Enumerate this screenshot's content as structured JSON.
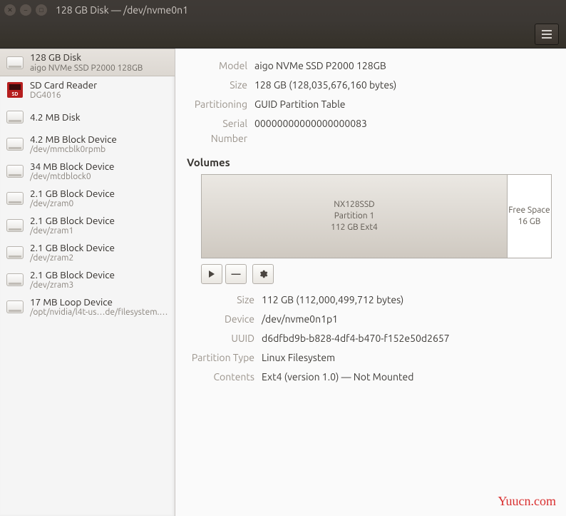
{
  "window": {
    "title": "128 GB Disk — /dev/nvme0n1"
  },
  "sidebar": {
    "devices": [
      {
        "primary": "128 GB Disk",
        "secondary": "aigo NVMe SSD P2000 128GB",
        "icon": "hdd",
        "selected": true
      },
      {
        "primary": "SD Card Reader",
        "secondary": "DG4016",
        "icon": "sd",
        "selected": false
      },
      {
        "primary": "4.2 MB Disk",
        "secondary": "",
        "icon": "hdd",
        "selected": false
      },
      {
        "primary": "4.2 MB Block Device",
        "secondary": "/dev/mmcblk0rpmb",
        "icon": "hdd",
        "selected": false
      },
      {
        "primary": "34 MB Block Device",
        "secondary": "/dev/mtdblock0",
        "icon": "hdd",
        "selected": false
      },
      {
        "primary": "2.1 GB Block Device",
        "secondary": "/dev/zram0",
        "icon": "hdd",
        "selected": false
      },
      {
        "primary": "2.1 GB Block Device",
        "secondary": "/dev/zram1",
        "icon": "hdd",
        "selected": false
      },
      {
        "primary": "2.1 GB Block Device",
        "secondary": "/dev/zram2",
        "icon": "hdd",
        "selected": false
      },
      {
        "primary": "2.1 GB Block Device",
        "secondary": "/dev/zram3",
        "icon": "hdd",
        "selected": false
      },
      {
        "primary": "17 MB Loop Device",
        "secondary": "/opt/nvidia/l4t-us…de/filesystem.img",
        "icon": "hdd",
        "selected": false
      }
    ]
  },
  "drive": {
    "labels": {
      "model": "Model",
      "size": "Size",
      "partitioning": "Partitioning",
      "serial": "Serial Number"
    },
    "model": "aigo NVMe SSD P2000 128GB",
    "size": "128 GB (128,035,676,160 bytes)",
    "partitioning": "GUID Partition Table",
    "serial": "00000000000000000083"
  },
  "volumes": {
    "heading": "Volumes",
    "partitions": [
      {
        "name": "NX128SSD",
        "desc": "Partition 1",
        "fs": "112 GB Ext4",
        "weight": 112
      },
      {
        "name": "Free Space",
        "desc": "16 GB",
        "fs": "",
        "weight": 16
      }
    ]
  },
  "vol_detail": {
    "labels": {
      "size": "Size",
      "device": "Device",
      "uuid": "UUID",
      "ptype": "Partition Type",
      "contents": "Contents"
    },
    "size": "112 GB (112,000,499,712 bytes)",
    "device": "/dev/nvme0n1p1",
    "uuid": "d6dfbd9b-b828-4df4-b470-f152e50d2657",
    "ptype": "Linux Filesystem",
    "contents": "Ext4 (version 1.0) — Not Mounted"
  },
  "watermark": "Yuucn.com"
}
